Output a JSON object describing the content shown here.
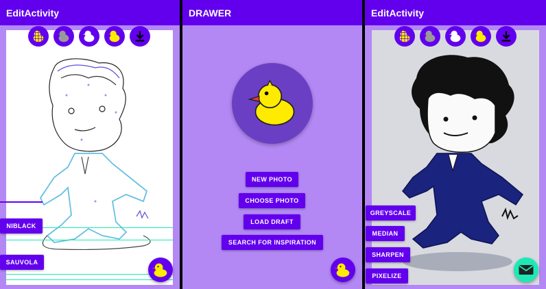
{
  "colors": {
    "primary": "#6200ee",
    "panel_bg": "#b388f5",
    "accent": "#1de9b6",
    "duck": "#ffeb00",
    "duck_beak": "#e53935"
  },
  "screen_edit_1": {
    "title": "EditActivity",
    "tools": [
      {
        "icon": "duck-grid-icon"
      },
      {
        "icon": "duck-grey-icon"
      },
      {
        "icon": "duck-white-icon"
      },
      {
        "icon": "duck-yellow-icon"
      },
      {
        "icon": "download-icon"
      }
    ],
    "buttons": {
      "niblack": "NIBLACK",
      "sauvola": "SAUVOLA"
    },
    "fab_icon": "duck-icon"
  },
  "screen_drawer": {
    "title": "DRAWER",
    "avatar_icon": "duck-icon",
    "buttons": {
      "new_photo": "NEW PHOTO",
      "choose_photo": "CHOOSE PHOTO",
      "load_draft": "LOAD DRAFT",
      "search": "SEARCH FOR INSPIRATION"
    },
    "fab_icon": "duck-icon"
  },
  "screen_edit_2": {
    "title": "EditActivity",
    "tools": [
      {
        "icon": "duck-grid-icon"
      },
      {
        "icon": "duck-grey-icon"
      },
      {
        "icon": "duck-white-icon"
      },
      {
        "icon": "duck-yellow-icon"
      },
      {
        "icon": "download-icon"
      }
    ],
    "buttons": {
      "greyscale": "GREYSCALE",
      "median": "MEDIAN",
      "sharpen": "SHARPEN",
      "pixelize": "PIXELIZE"
    },
    "fab_icon": "mail-icon"
  }
}
